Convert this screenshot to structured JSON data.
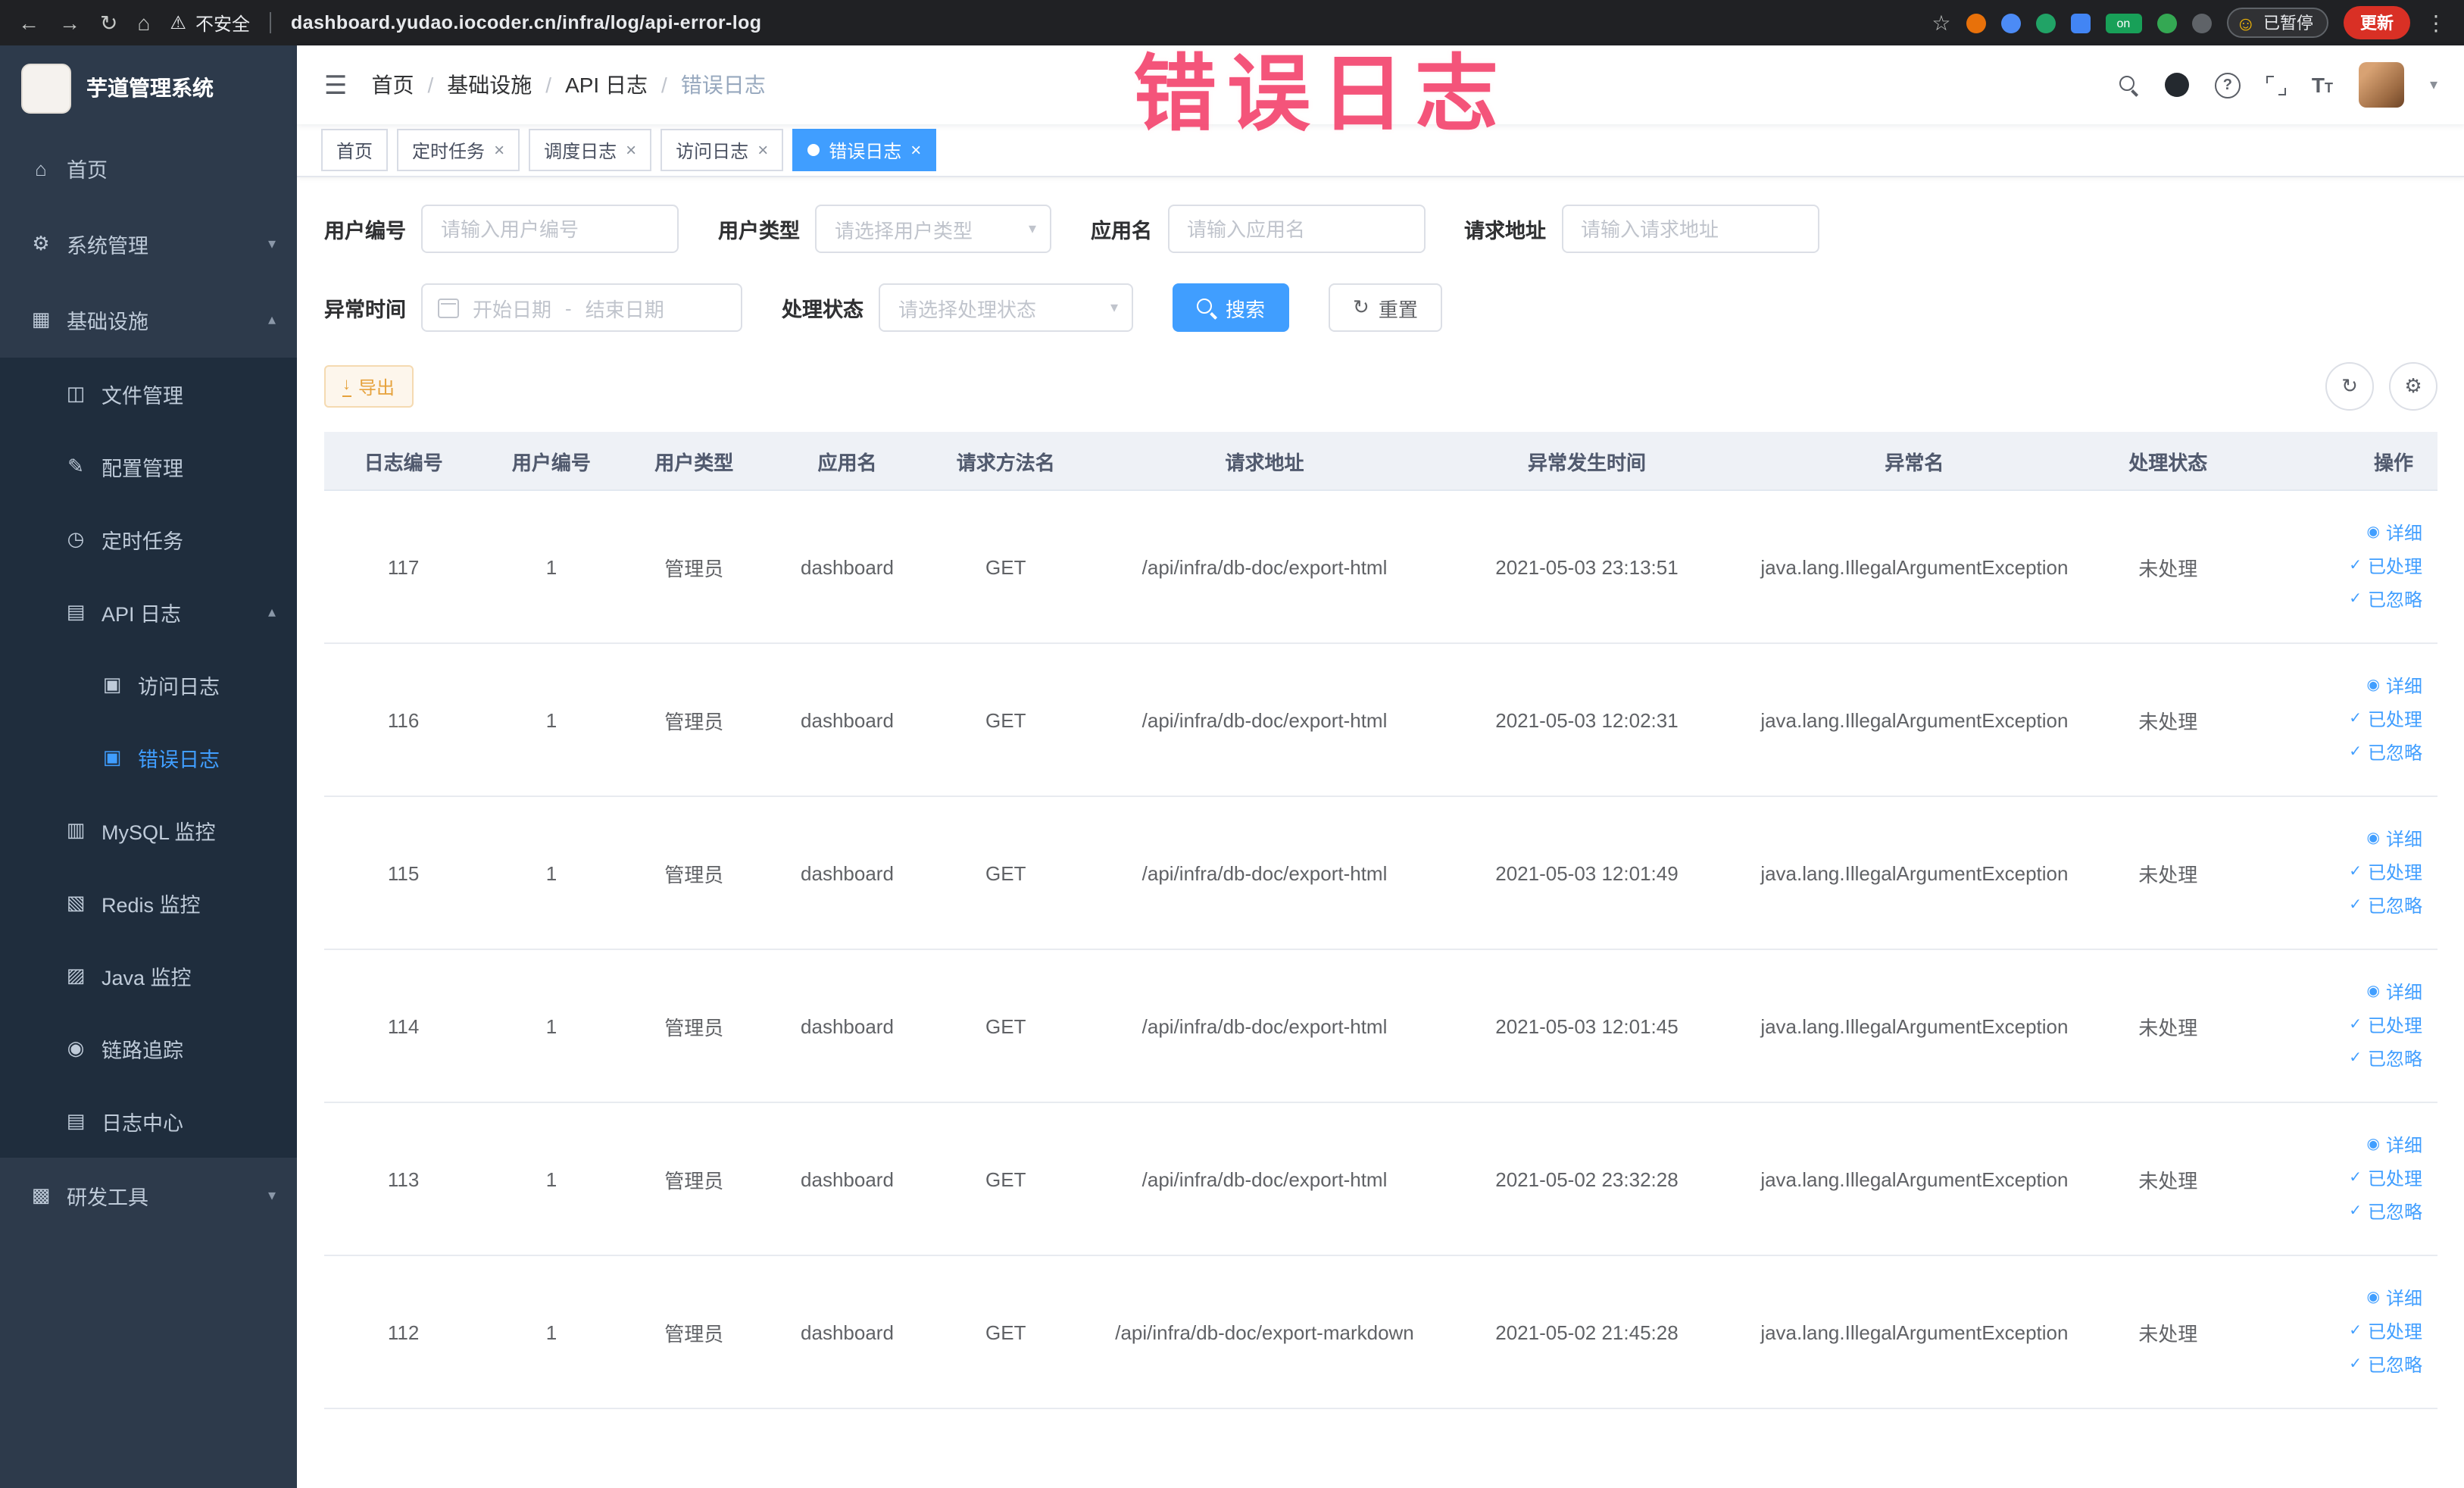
{
  "browser": {
    "security_label": "不安全",
    "url": "dashboard.yudao.iocoder.cn/infra/log/api-error-log",
    "on_badge": "on",
    "paused_badge": "已暂停",
    "update_button": "更新"
  },
  "annotation": {
    "text": "错误日志"
  },
  "icons": {
    "back": "←",
    "forward": "→",
    "reload": "↻",
    "home": "⌂",
    "warning": "⚠",
    "star": "☆",
    "smiley": "☺",
    "menu_dots": "⋮",
    "hamburger": "☰",
    "caret_down": "▾",
    "caret_up": "▴",
    "close": "×",
    "question": "?",
    "fontsize": "T",
    "download": "↓",
    "refresh": "↻",
    "gear": "⚙",
    "eye": "◉",
    "check": "✓",
    "nav_home": "⌂",
    "nav_system": "⚙",
    "nav_infra": "▦",
    "nav_file": "◫",
    "nav_config": "✎",
    "nav_timer": "◷",
    "nav_apilog": "▤",
    "nav_accesslog": "▣",
    "nav_errorlog": "▣",
    "nav_mysql": "▥",
    "nav_redis": "▧",
    "nav_java": "▨",
    "nav_trace": "◉",
    "nav_logcenter": "▤",
    "nav_devtools": "▩"
  },
  "sidebar": {
    "logo_title": "芋道管理系统",
    "items": [
      {
        "label": "首页"
      },
      {
        "label": "系统管理"
      },
      {
        "label": "基础设施"
      },
      {
        "label": "文件管理"
      },
      {
        "label": "配置管理"
      },
      {
        "label": "定时任务"
      },
      {
        "label": "API 日志"
      },
      {
        "label": "访问日志"
      },
      {
        "label": "错误日志"
      },
      {
        "label": "MySQL 监控"
      },
      {
        "label": "Redis 监控"
      },
      {
        "label": "Java 监控"
      },
      {
        "label": "链路追踪"
      },
      {
        "label": "日志中心"
      },
      {
        "label": "研发工具"
      }
    ]
  },
  "breadcrumb": {
    "separator": "/",
    "items": [
      "首页",
      "基础设施",
      "API 日志",
      "错误日志"
    ]
  },
  "tabs": [
    {
      "label": "首页"
    },
    {
      "label": "定时任务"
    },
    {
      "label": "调度日志"
    },
    {
      "label": "访问日志"
    },
    {
      "label": "错误日志"
    }
  ],
  "filters": {
    "user_id": {
      "label": "用户编号",
      "placeholder": "请输入用户编号"
    },
    "user_type": {
      "label": "用户类型",
      "placeholder": "请选择用户类型"
    },
    "app_name": {
      "label": "应用名",
      "placeholder": "请输入应用名"
    },
    "request_url": {
      "label": "请求地址",
      "placeholder": "请输入请求地址"
    },
    "exception_time": {
      "label": "异常时间",
      "start_placeholder": "开始日期",
      "end_placeholder": "结束日期",
      "separator": "-"
    },
    "process_status": {
      "label": "处理状态",
      "placeholder": "请选择处理状态"
    },
    "search_button": "搜索",
    "reset_button": "重置"
  },
  "toolbar": {
    "export_button": "导出"
  },
  "table": {
    "headers": [
      "日志编号",
      "用户编号",
      "用户类型",
      "应用名",
      "请求方法名",
      "请求地址",
      "异常发生时间",
      "异常名",
      "处理状态",
      "操作"
    ],
    "actions": {
      "detail": "详细",
      "processed": "已处理",
      "ignored": "已忽略"
    },
    "rows": [
      {
        "log_id": "117",
        "user_id": "1",
        "user_type": "管理员",
        "app_name": "dashboard",
        "method": "GET",
        "url": "/api/infra/db-doc/export-html",
        "time": "2021-05-03 23:13:51",
        "exception": "java.lang.IllegalArgumentException",
        "status": "未处理"
      },
      {
        "log_id": "116",
        "user_id": "1",
        "user_type": "管理员",
        "app_name": "dashboard",
        "method": "GET",
        "url": "/api/infra/db-doc/export-html",
        "time": "2021-05-03 12:02:31",
        "exception": "java.lang.IllegalArgumentException",
        "status": "未处理"
      },
      {
        "log_id": "115",
        "user_id": "1",
        "user_type": "管理员",
        "app_name": "dashboard",
        "method": "GET",
        "url": "/api/infra/db-doc/export-html",
        "time": "2021-05-03 12:01:49",
        "exception": "java.lang.IllegalArgumentException",
        "status": "未处理"
      },
      {
        "log_id": "114",
        "user_id": "1",
        "user_type": "管理员",
        "app_name": "dashboard",
        "method": "GET",
        "url": "/api/infra/db-doc/export-html",
        "time": "2021-05-03 12:01:45",
        "exception": "java.lang.IllegalArgumentException",
        "status": "未处理"
      },
      {
        "log_id": "113",
        "user_id": "1",
        "user_type": "管理员",
        "app_name": "dashboard",
        "method": "GET",
        "url": "/api/infra/db-doc/export-html",
        "time": "2021-05-02 23:32:28",
        "exception": "java.lang.IllegalArgumentException",
        "status": "未处理"
      },
      {
        "log_id": "112",
        "user_id": "1",
        "user_type": "管理员",
        "app_name": "dashboard",
        "method": "GET",
        "url": "/api/infra/db-doc/export-markdown",
        "time": "2021-05-02 21:45:28",
        "exception": "java.lang.IllegalArgumentException",
        "status": "未处理"
      }
    ]
  },
  "colors": {
    "accent": "#409eff",
    "sidebar_bg": "#2d3a4b",
    "submenu_bg": "#1f2d3d",
    "warning_text": "#e6a23c",
    "annotation": "#f4466f"
  }
}
